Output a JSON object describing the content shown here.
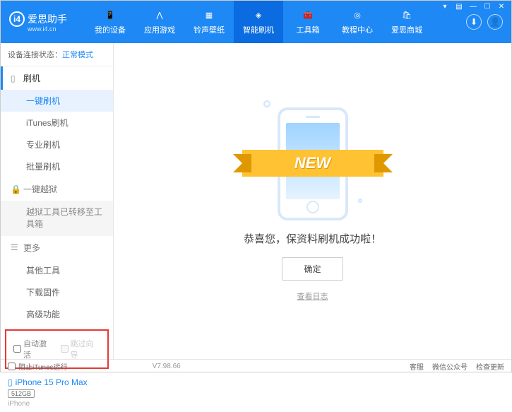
{
  "header": {
    "app_name": "爱思助手",
    "app_url": "www.i4.cn",
    "nav": [
      {
        "label": "我的设备"
      },
      {
        "label": "应用游戏"
      },
      {
        "label": "铃声壁纸"
      },
      {
        "label": "智能刷机"
      },
      {
        "label": "工具箱"
      },
      {
        "label": "教程中心"
      },
      {
        "label": "爱思商城"
      }
    ]
  },
  "status": {
    "label": "设备连接状态：",
    "mode": "正常模式"
  },
  "sidebar": {
    "flash": {
      "title": "刷机",
      "items": [
        "一键刷机",
        "iTunes刷机",
        "专业刷机",
        "批量刷机"
      ]
    },
    "jailbreak": {
      "title": "一键越狱",
      "note": "越狱工具已转移至工具箱"
    },
    "more": {
      "title": "更多",
      "items": [
        "其他工具",
        "下载固件",
        "高级功能"
      ]
    },
    "checkboxes": {
      "auto_activate": "自动激活",
      "skip_guide": "跳过向导"
    },
    "device": {
      "name": "iPhone 15 Pro Max",
      "storage": "512GB",
      "type": "iPhone"
    }
  },
  "main": {
    "ribbon": "NEW",
    "success": "恭喜您，保资料刷机成功啦！",
    "ok": "确定",
    "log": "查看日志"
  },
  "footer": {
    "block_itunes": "阻止iTunes运行",
    "version": "V7.98.66",
    "links": [
      "客服",
      "微信公众号",
      "检查更新"
    ]
  }
}
